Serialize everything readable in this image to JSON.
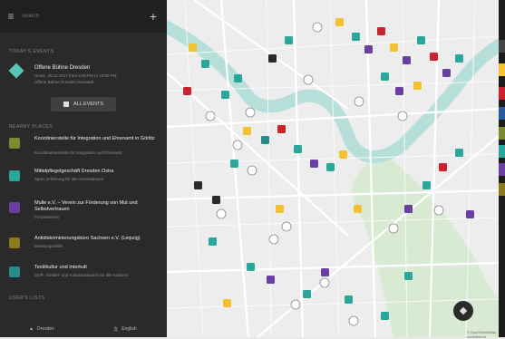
{
  "search": {
    "placeholder": "Search"
  },
  "sections": {
    "events": "TODAY'S EVENTS",
    "places": "NEARBY PLACES",
    "lists": "USER'S LISTS"
  },
  "event": {
    "title": "Offene Bühne Dresden",
    "line1": "Heute, 28.11.2017 from 6:00 PM to 10:00 PM",
    "line2": "Offene Bühne Dresden Neustadt"
  },
  "all_events_label": "ALL EVENTS",
  "places": [
    {
      "title": "Koordinierstelle für Integration und Ehrenamt in Görlitz",
      "sub": "Koordinationsstelle für Integration und Ehrenamt",
      "color": "#7a8a2e"
    },
    {
      "title": "Mittelpflegelgeschäft Dresden Ostra",
      "sub": "Sport, Erfahrung für alle Generationen",
      "color": "#2aa79b"
    },
    {
      "title": "Mulle e.V. – Verein zur Förderung von Mut und Selbstvertrauen",
      "sub": "Freizeitverein",
      "color": "#6b3fa0"
    },
    {
      "title": "Antidiskriminierungsbüro Sachsen e.V. (Leipzig)",
      "sub": "Beratungsstelle",
      "color": "#8a7a1e"
    },
    {
      "title": "Textilkultur und Interkult",
      "sub": "Stoff-, Kleider- und Kulturaustausch für alle Kulturen",
      "color": "#2a8a8a"
    }
  ],
  "footer": {
    "city": "Dresden",
    "language": "English"
  },
  "map": {
    "attribution": "© OpenStreetMap contributors"
  },
  "colors": {
    "sidebar": "#2a2a2a",
    "accent": "#58c4b6",
    "river": "#b6dfd9",
    "park": "#d7ead0"
  }
}
